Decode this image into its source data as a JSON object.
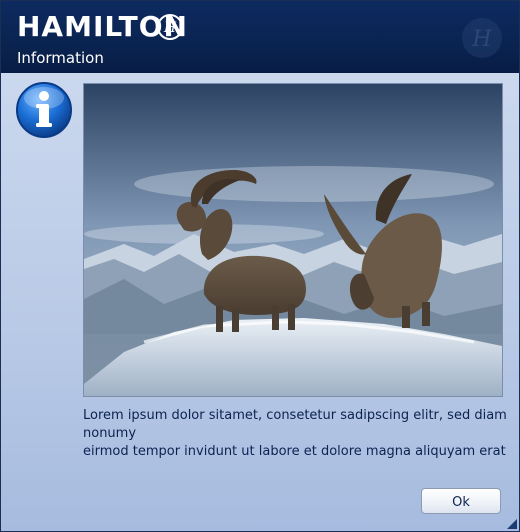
{
  "header": {
    "brand": "HAMILTON",
    "title": "Information"
  },
  "icons": {
    "logo_mark": "hamilton-h-icon",
    "watermark": "hamilton-watermark-icon",
    "info": "info-icon",
    "resize": "resize-grip-icon"
  },
  "colors": {
    "header_bg": "#0a2350",
    "content_bg": "#c7d5ec",
    "text": "#0c2350"
  },
  "message": {
    "line1": "Lorem ipsum dolor sitamet, consetetur sadipscing elitr, sed diam",
    "line2": "nonumy",
    "line3": "eirmod tempor invidunt ut labore et dolore magna aliquyam erat"
  },
  "buttons": {
    "ok_label": "Ok"
  }
}
